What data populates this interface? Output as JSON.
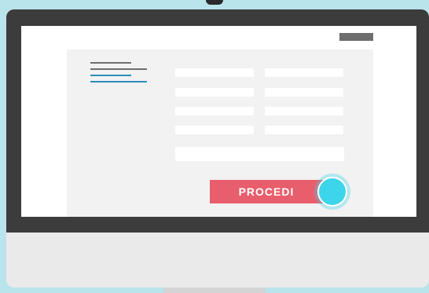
{
  "form": {
    "submit_label": "PROCEDI"
  },
  "icons": {
    "cursor": "click-cursor-icon"
  },
  "colors": {
    "background": "#b9e4ec",
    "bezel": "#3c3c3c",
    "chin": "#eaeaea",
    "panel": "#f2f2f2",
    "accent_link": "#2b8dbb",
    "button": "#e95e6c",
    "cursor": "#3dd5ec"
  }
}
